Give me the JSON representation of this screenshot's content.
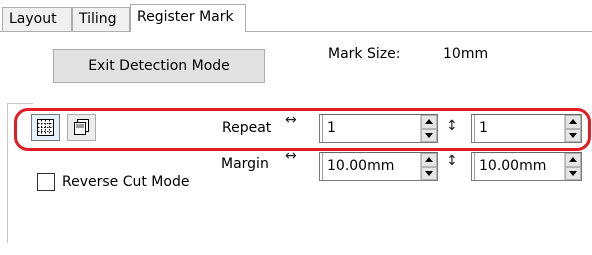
{
  "tabs": [
    {
      "label": "Layout"
    },
    {
      "label": "Tiling"
    },
    {
      "label": "Register Mark"
    }
  ],
  "exit_button": {
    "label": "Exit Detection Mode"
  },
  "mark_size": {
    "label": "Mark Size:",
    "value": "10mm"
  },
  "repeat": {
    "label": "Repeat",
    "horizontal_value": "1",
    "vertical_value": "1"
  },
  "margin": {
    "label": "Margin",
    "horizontal_value": "10.00mm",
    "vertical_value": "10.00mm"
  },
  "reverse_cut": {
    "label": "Reverse Cut Mode",
    "checked": false
  },
  "icons": {
    "horizontal_arrow": "↔",
    "vertical_arrow": "↕",
    "grid_layout": "grid-layout-icon",
    "copy_layout": "copy-layout-icon"
  },
  "colors": {
    "highlight": "#e21b24"
  }
}
